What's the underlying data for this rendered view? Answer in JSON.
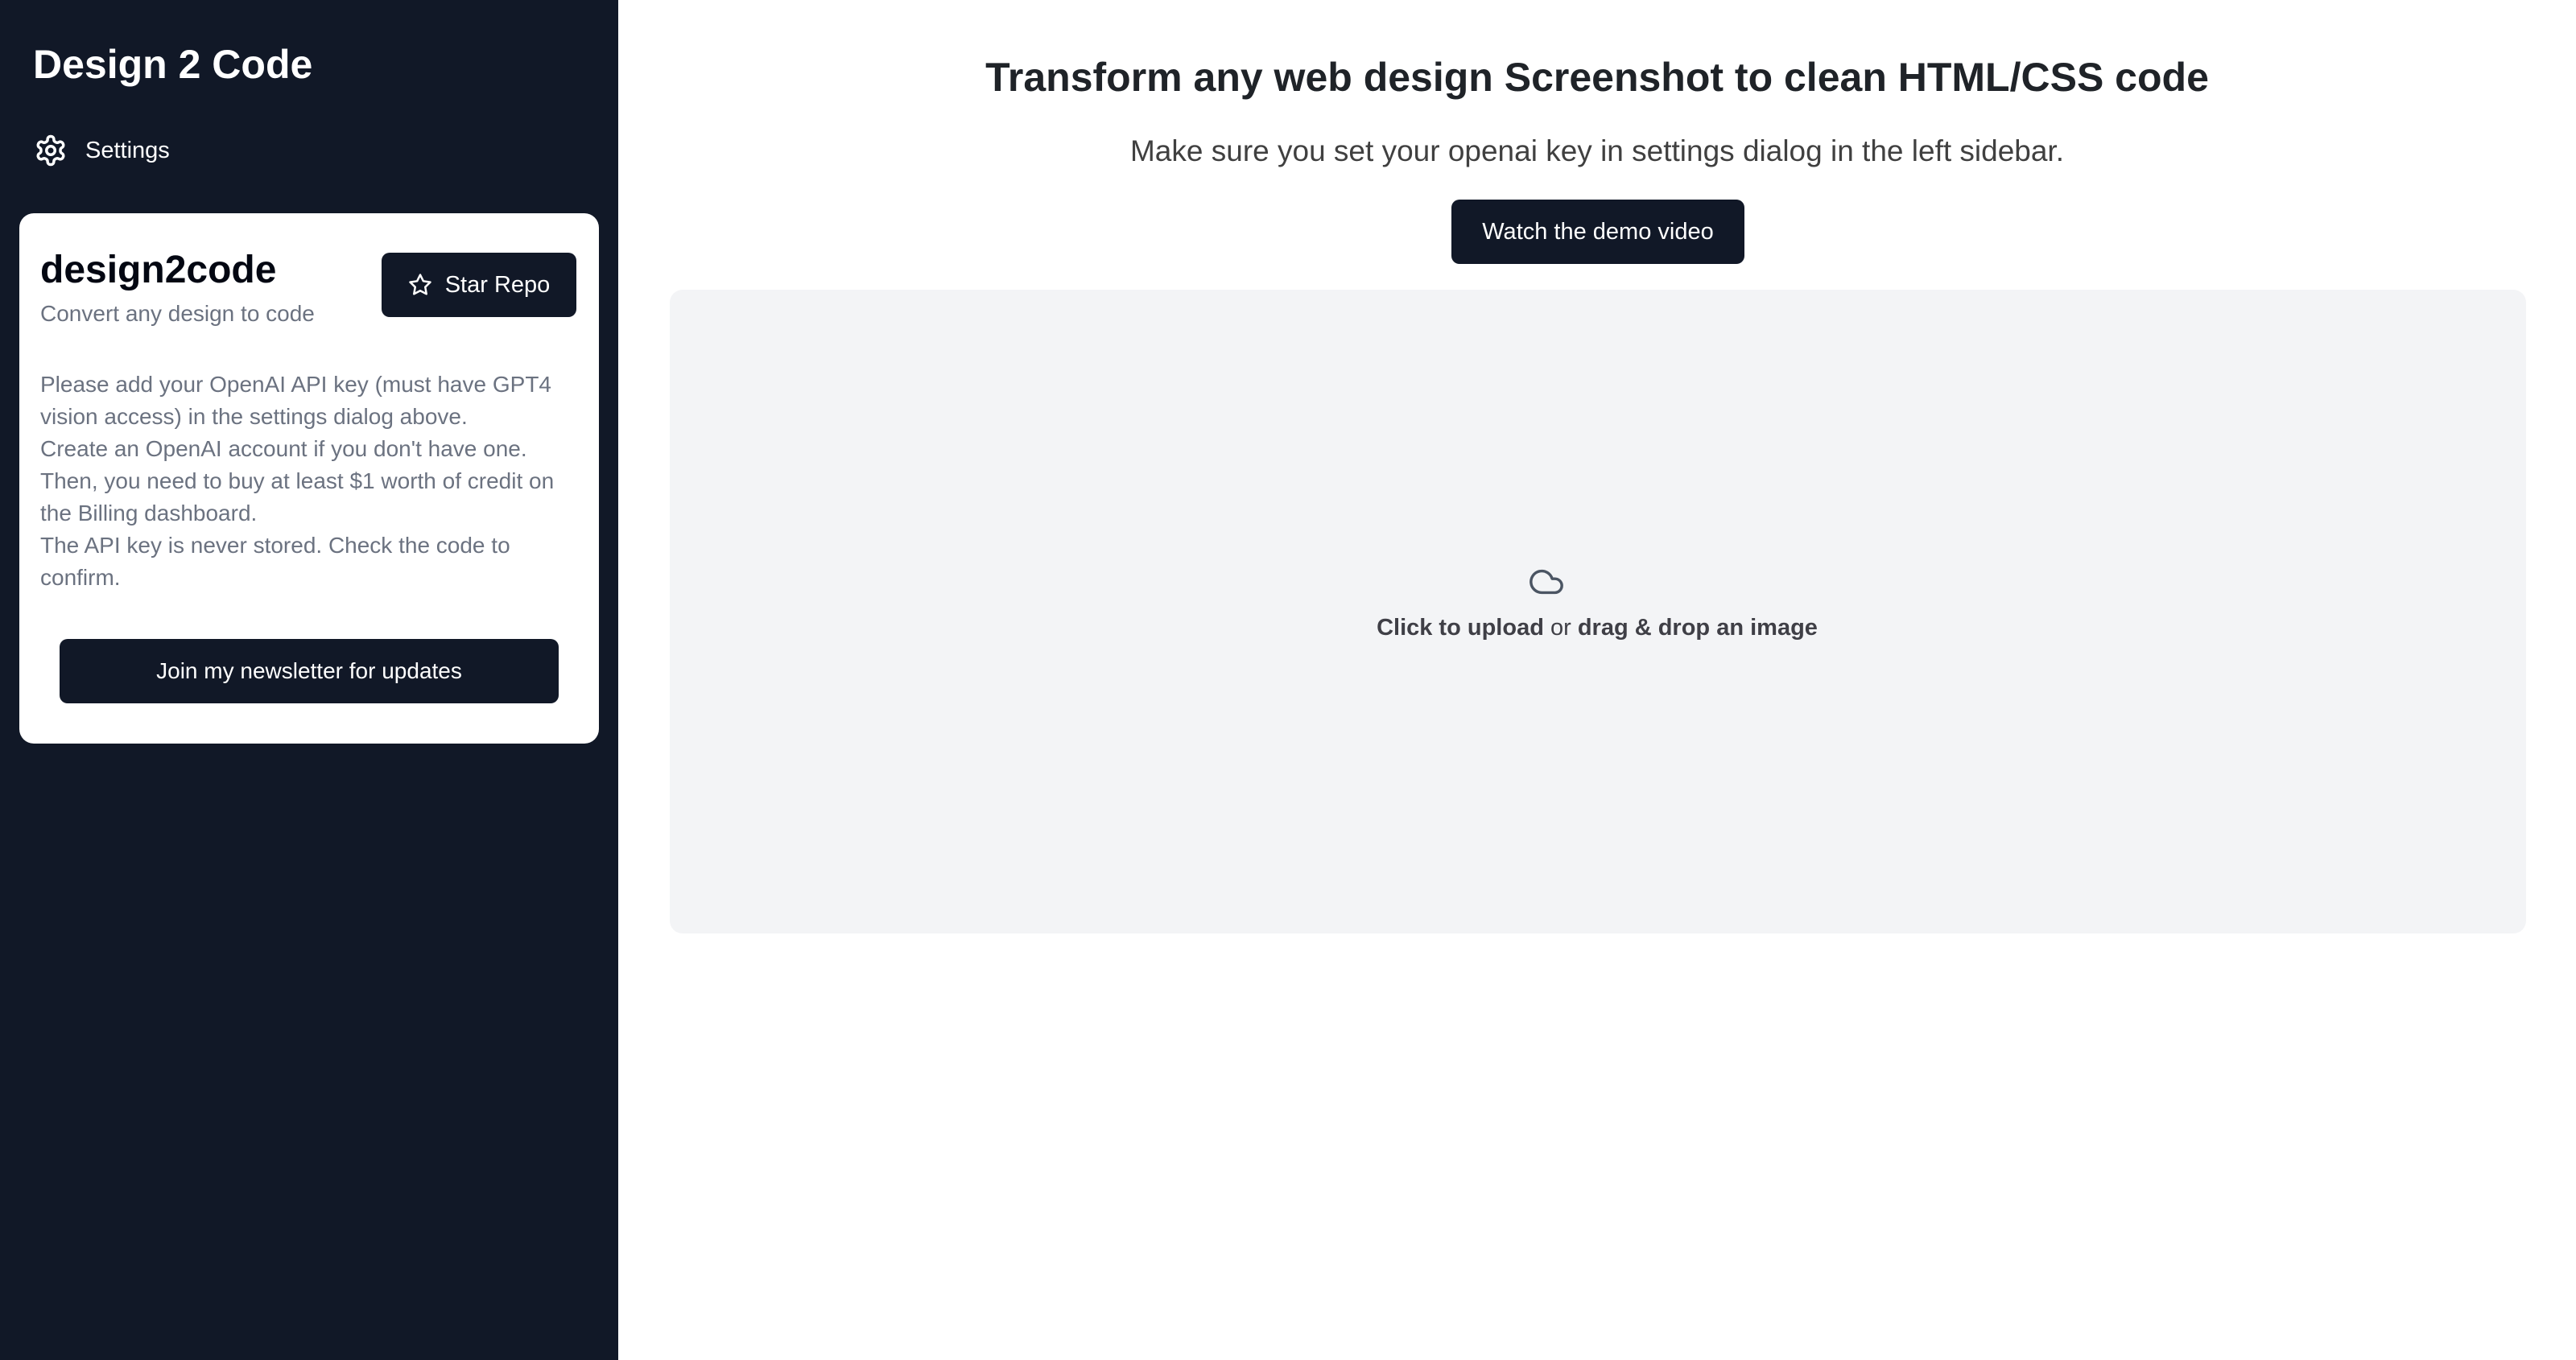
{
  "sidebar": {
    "app_title": "Design 2 Code",
    "settings": {
      "label": "Settings",
      "icon": "gear-icon"
    },
    "card": {
      "title": "design2code",
      "subtitle": "Convert any design to code",
      "star_button": {
        "label": "Star Repo",
        "icon": "star-icon"
      },
      "info_lines": [
        "Please add your OpenAI API key (must have GPT4 vision access) in the settings dialog above.",
        "Create an OpenAI account if you don't have one. Then, you need to buy at least $1 worth of credit on the Billing dashboard.",
        "The API key is never stored. Check the code to confirm."
      ],
      "newsletter_button": "Join my newsletter for updates"
    }
  },
  "main": {
    "title": "Transform any web design Screenshot to clean HTML/CSS code",
    "subtitle": "Make sure you set your openai key in settings dialog in the left sidebar.",
    "demo_button": "Watch the demo video",
    "dropzone": {
      "icon": "cloud-icon",
      "upload_link": "Click to upload",
      "connector": " or ",
      "drag_text": "drag & drop an image"
    }
  },
  "colors": {
    "sidebar_bg": "#111827",
    "button_bg": "#111827",
    "dropzone_bg": "#f3f4f6",
    "muted_text": "#6b7280"
  }
}
